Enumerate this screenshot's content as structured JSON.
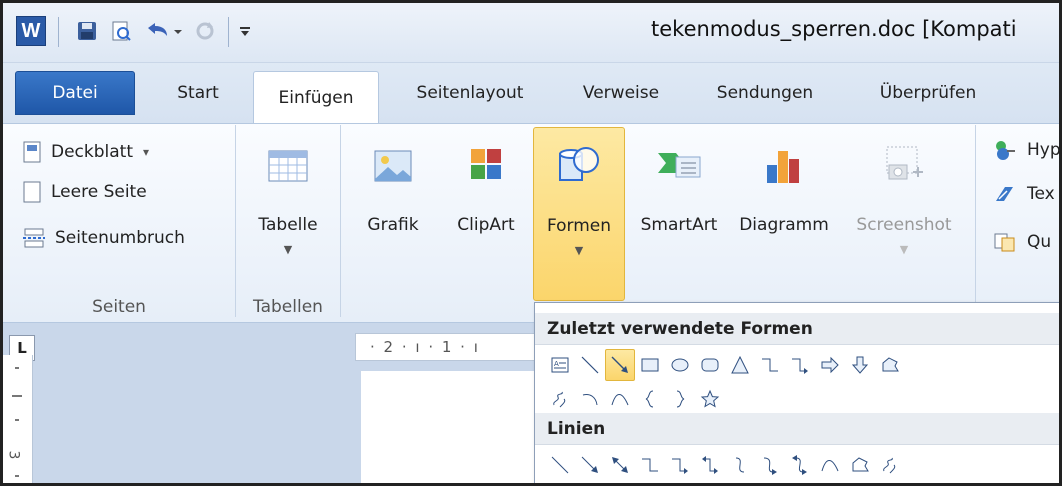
{
  "titlebar": {
    "app_icon_letter": "W",
    "document_title": "tekenmodus_sperren.doc [Kompati",
    "quick_access": [
      "save-icon",
      "print-preview-icon",
      "undo-icon",
      "redo-icon",
      "customize-dropdown-icon"
    ]
  },
  "tabs": [
    "Datei",
    "Start",
    "Einfügen",
    "Seitenlayout",
    "Verweise",
    "Sendungen",
    "Überprüfen"
  ],
  "active_tab": "Einfügen",
  "ribbon": {
    "seiten": {
      "items": [
        "Deckblatt",
        "Leere Seite",
        "Seitenumbruch"
      ],
      "deckblatt_dropdown": "▾",
      "label": "Seiten"
    },
    "tabellen": {
      "button": "Tabelle",
      "label": "Tabellen"
    },
    "illustrationen": {
      "buttons": [
        "Grafik",
        "ClipArt",
        "Formen",
        "SmartArt",
        "Diagramm",
        "Screenshot"
      ]
    },
    "links": {
      "items": [
        "Hyp",
        "Tex",
        "Qu"
      ]
    }
  },
  "ruler": {
    "text": "· 2 · ı · 1 · ı",
    "vertical_number": "3",
    "corner_label": "L"
  },
  "gallery": {
    "sections": [
      {
        "title": "Zuletzt verwendete Formen"
      },
      {
        "title": "Linien"
      }
    ]
  },
  "colors": {
    "accent_file_tab": "#1f57a8",
    "highlight": "#fbd56b",
    "ribbon_bg": "#e6eef8"
  }
}
